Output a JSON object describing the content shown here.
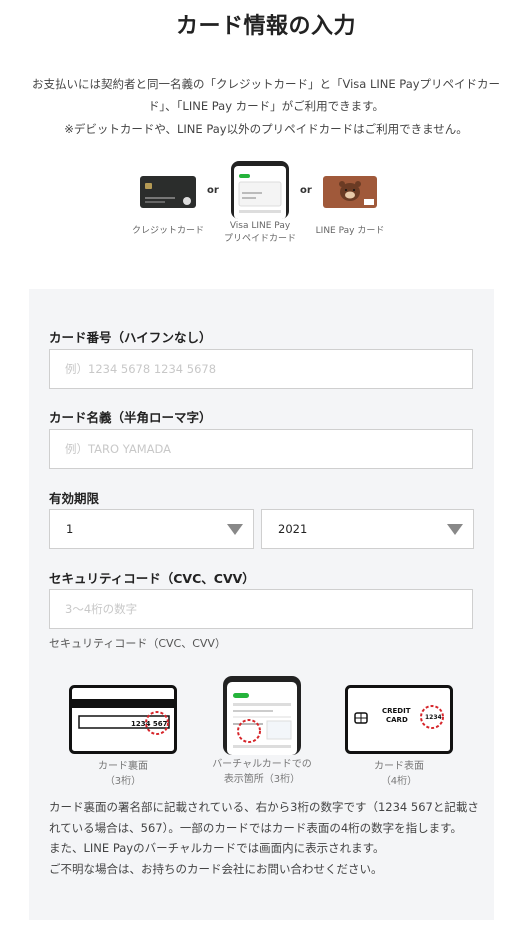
{
  "title": "カード情報の入力",
  "intro": "お支払いには契約者と同一名義の「クレジットカード」と「Visa LINE Payプリペイドカード」、「LINE Pay カード」がご利用できます。",
  "note": "※デビットカードや、LINE Pay以外のプリペイドカードはご利用できません。",
  "card_options": {
    "credit": "クレジットカード",
    "visa_line1": "Visa LINE Pay",
    "visa_line2": "プリペイドカード",
    "linepay": "LINE Pay カード",
    "or": "or"
  },
  "form": {
    "card_number_label": "カード番号（ハイフンなし）",
    "card_number_placeholder": "例）1234 5678 1234 5678",
    "card_name_label": "カード名義（半角ローマ字）",
    "card_name_placeholder": "例）TARO YAMADA",
    "expiry_label": "有効期限",
    "expiry_month": "1",
    "expiry_year": "2021",
    "cvc_label": "セキュリティコード（CVC、CVV）",
    "cvc_placeholder": "3～4桁の数字",
    "cvc_sublabel": "セキュリティコード（CVC、CVV）"
  },
  "illustrations": {
    "back_line1": "カード裏面",
    "back_line2": "（3桁）",
    "back_number": "1234 567",
    "virtual_line1": "バーチャルカードでの",
    "virtual_line2": "表示箇所（3桁）",
    "front_line1": "カード表面",
    "front_line2": "（4桁）",
    "front_text1": "CREDIT",
    "front_text2": "CARD",
    "front_number": "1234"
  },
  "description": {
    "line1": "カード裏面の署名部に記載されている、右から3桁の数字です（1234 567と記載されている場合は、567）。一部のカードではカード表面の4桁の数字を指します。",
    "line2": "また、LINE Payのバーチャルカードでは画面内に表示されます。",
    "line3": "ご不明な場合は、お持ちのカード会社にお問い合わせください。"
  },
  "colors": {
    "accent_red": "#d6262b",
    "panel_bg": "#f4f5f7",
    "linepay_brown": "#a0593a"
  }
}
